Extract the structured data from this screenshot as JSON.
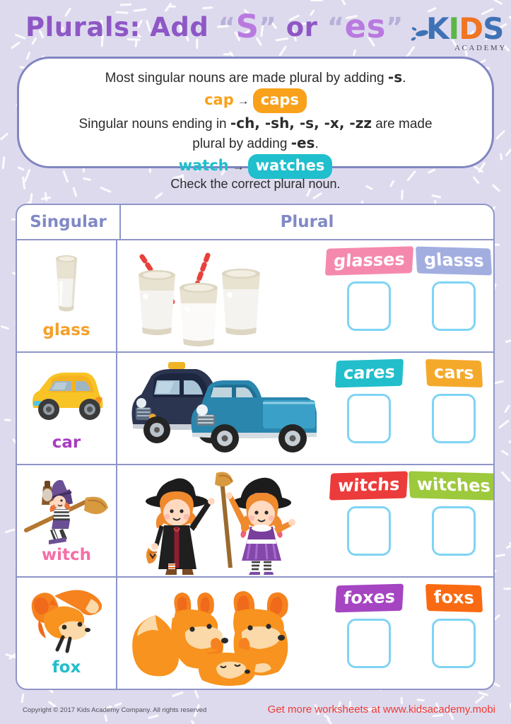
{
  "header": {
    "title_prefix": "Plurals: Add",
    "quote_open": "“",
    "suffix_s": "S",
    "quote_close": "”",
    "conjunction": "or",
    "suffix_es": "es",
    "logo": {
      "letter_k": "K",
      "letter_i": "I",
      "letter_d": "D",
      "letter_s": "S",
      "subtitle": "ACADEMY"
    },
    "colors": {
      "title": "#8E57C6",
      "title_accent": "#b97ae0",
      "logo_blue": "#3f72b5",
      "logo_green": "#5cb646",
      "logo_orange": "#ef7523"
    }
  },
  "rulebox": {
    "line1_before": "Most singular nouns are made plural by adding ",
    "line1_bold": "-s",
    "line1_after": ".",
    "example1": {
      "singular": "cap",
      "arrow": "→",
      "plural": "caps",
      "color": "#f9a11b"
    },
    "line2_before": "Singular nouns ending in ",
    "line2_bold": "-ch, -sh, -s, -x, -zz",
    "line2_after": " are made",
    "line3_before": "plural by adding ",
    "line3_bold": "-es",
    "line3_after": ".",
    "example2": {
      "singular": "watch",
      "arrow": "→",
      "plural": "watches",
      "color": "#1fbfcd"
    }
  },
  "prompt": "Check the correct plural noun.",
  "table": {
    "headers": {
      "singular": "Singular",
      "plural": "Plural"
    },
    "rows": [
      {
        "singular_word": "glass",
        "singular_color": "#f5a02a",
        "singular_art": "glass-of-milk",
        "plural_art": "three-glasses-of-milk",
        "options": [
          {
            "label": "glasses",
            "color": "#f589ad"
          },
          {
            "label": "glasss",
            "color": "#a3aee0"
          }
        ]
      },
      {
        "singular_word": "car",
        "singular_color": "#a93cc1",
        "singular_art": "yellow-car",
        "plural_art": "two-cars",
        "options": [
          {
            "label": "cares",
            "color": "#22becb"
          },
          {
            "label": "cars",
            "color": "#f5a92b"
          }
        ]
      },
      {
        "singular_word": "witch",
        "singular_color": "#f56ea6",
        "singular_art": "witch-on-broom",
        "plural_art": "two-witches",
        "options": [
          {
            "label": "witchs",
            "color": "#ec3b3b"
          },
          {
            "label": "witches",
            "color": "#9dc93c"
          }
        ]
      },
      {
        "singular_word": "fox",
        "singular_color": "#22becb",
        "singular_art": "one-fox",
        "plural_art": "three-foxes",
        "options": [
          {
            "label": "foxes",
            "color": "#a545c2"
          },
          {
            "label": "foxs",
            "color": "#f96a12"
          }
        ]
      }
    ]
  },
  "footer": {
    "copyright": "Copyright © 2017 Kids Academy Company.  All rights reserved",
    "link": "Get more worksheets at www.kidsacademy.mobi"
  }
}
